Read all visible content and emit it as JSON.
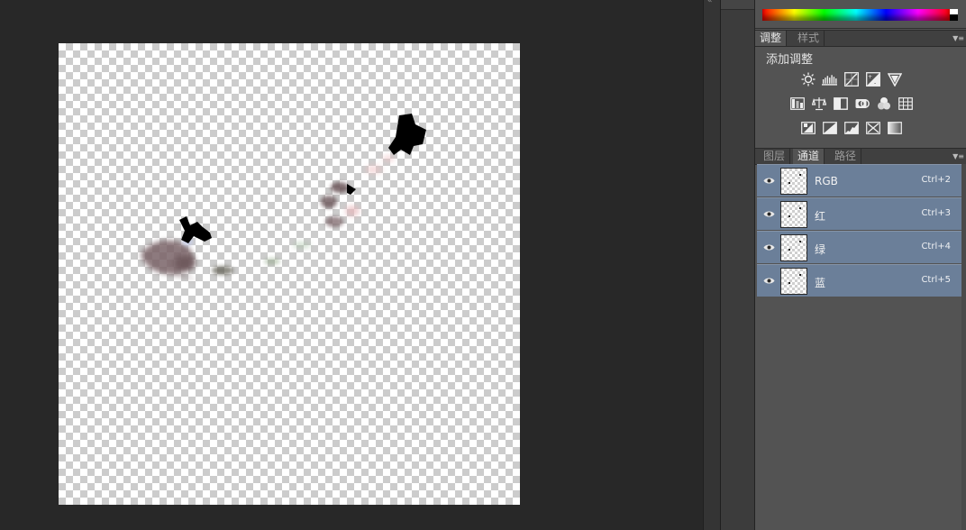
{
  "adjustments_panel": {
    "tabs": [
      "调整",
      "样式"
    ],
    "active_tab": "调整",
    "title": "添加调整",
    "icon_rows": [
      [
        "brightness-contrast-icon",
        "levels-icon",
        "curves-icon",
        "exposure-icon",
        "vibrance-icon"
      ],
      [
        "hue-saturation-icon",
        "color-balance-icon",
        "black-white-icon",
        "photo-filter-icon",
        "channel-mixer-icon",
        "color-lookup-icon"
      ],
      [
        "invert-icon",
        "posterize-icon",
        "threshold-icon",
        "selective-color-icon",
        "gradient-map-icon"
      ]
    ]
  },
  "layers_panel": {
    "tabs": [
      "图层",
      "通道",
      "路径"
    ],
    "active_tab": "通道",
    "channels": [
      {
        "name": "RGB",
        "shortcut": "Ctrl+2"
      },
      {
        "name": "红",
        "shortcut": "Ctrl+3"
      },
      {
        "name": "绿",
        "shortcut": "Ctrl+4"
      },
      {
        "name": "蓝",
        "shortcut": "Ctrl+5"
      }
    ]
  },
  "colors": {
    "workspace_bg": "#282828",
    "panel_bg": "#535353",
    "selected_row": "#6b7f99",
    "canvas_mark": "#000000"
  }
}
